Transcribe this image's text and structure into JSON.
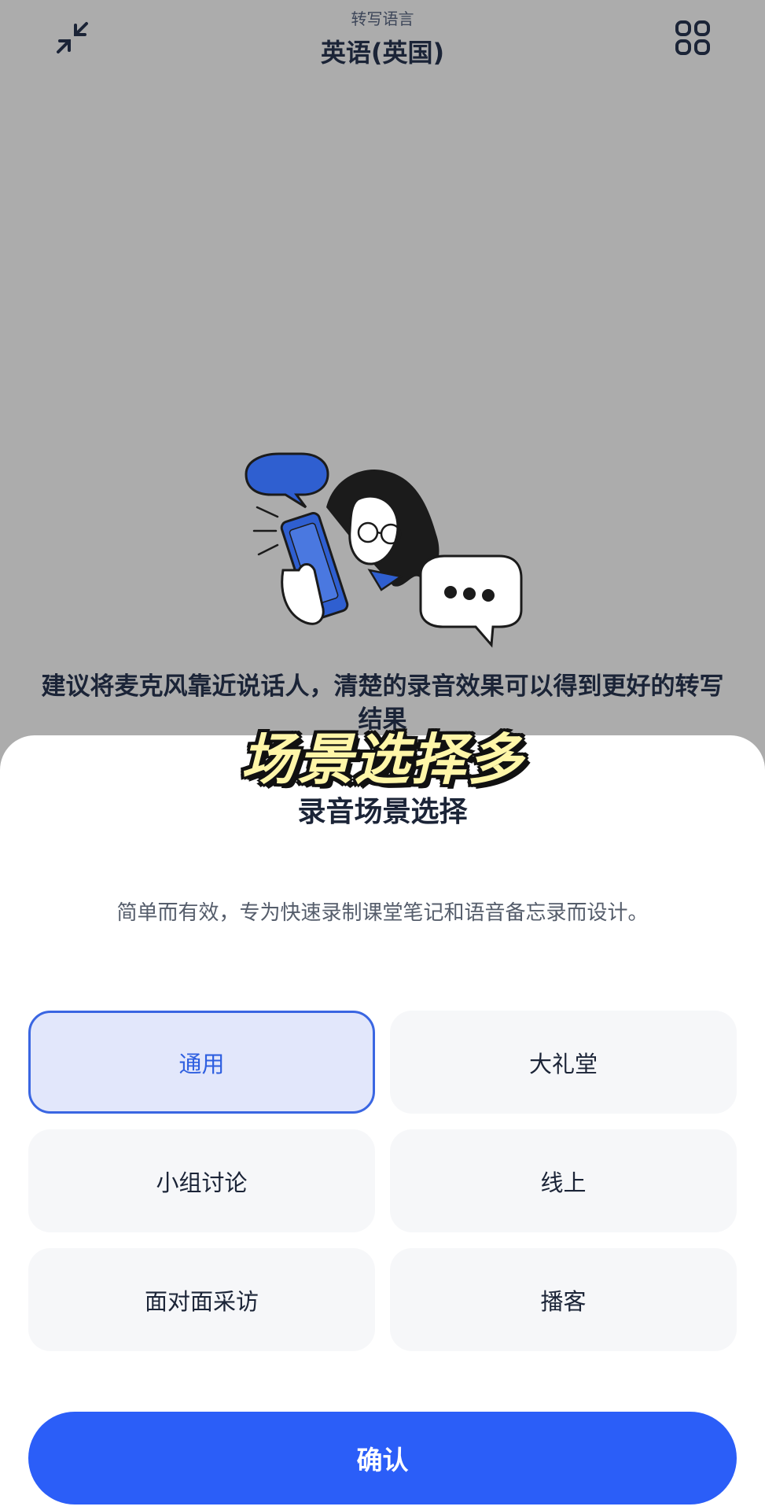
{
  "header": {
    "subtitle": "转写语言",
    "title": "英语(英国)"
  },
  "hint": "建议将麦克风靠近说话人，清楚的录音效果可以得到更好的转写结果",
  "overlay_caption": "场景选择多",
  "sheet": {
    "title": "录音场景选择",
    "description": "简单而有效，专为快速录制课堂笔记和语音备忘录而设计。",
    "options": [
      {
        "label": "通用",
        "selected": true
      },
      {
        "label": "大礼堂",
        "selected": false
      },
      {
        "label": "小组讨论",
        "selected": false
      },
      {
        "label": "线上",
        "selected": false
      },
      {
        "label": "面对面采访",
        "selected": false
      },
      {
        "label": "播客",
        "selected": false
      }
    ],
    "confirm_label": "确认"
  },
  "colors": {
    "accent": "#2b5ef8",
    "selected_bg": "#e2e7fb",
    "dimmed_bg": "#acacac"
  },
  "icons": [
    "collapse-arrows-icon",
    "grid-apps-icon"
  ]
}
